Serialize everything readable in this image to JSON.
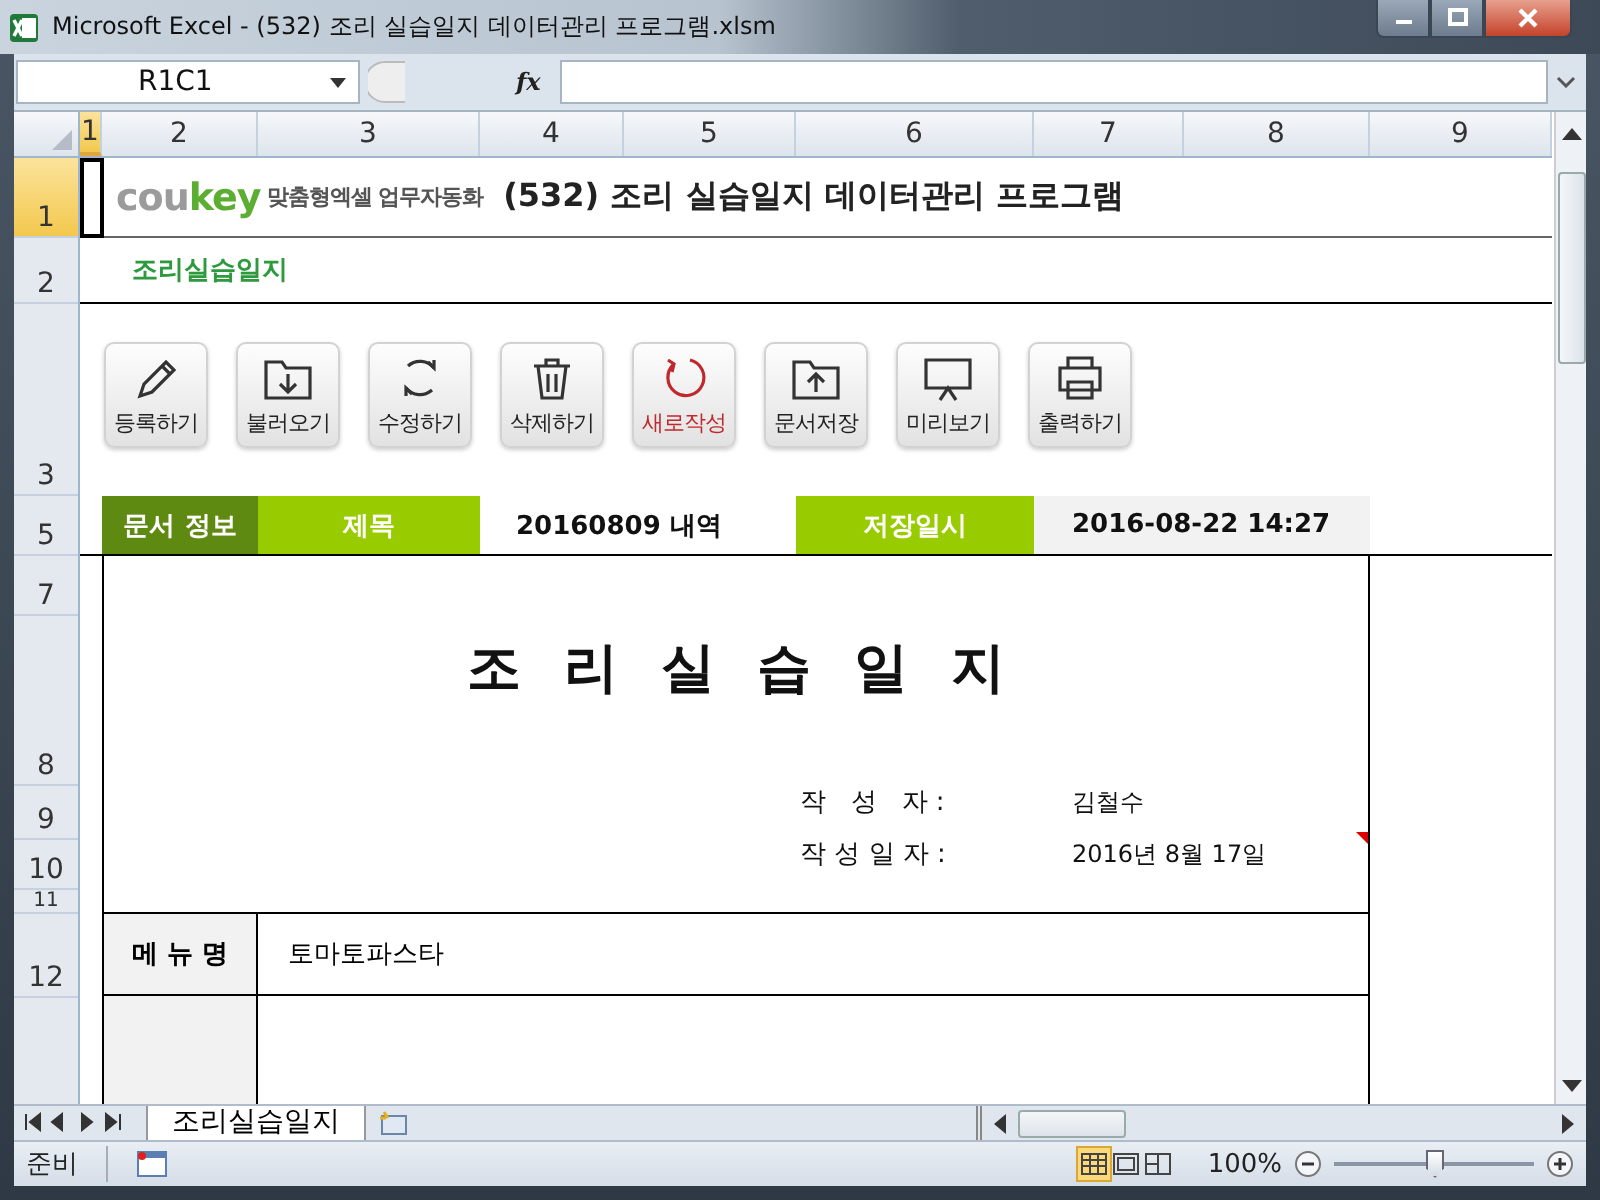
{
  "window": {
    "title": "Microsoft Excel - (532) 조리 실습일지 데이터관리 프로그램.xlsm"
  },
  "formula_bar": {
    "name_box": "R1C1",
    "function_label": "fx"
  },
  "columns": [
    {
      "label": "1",
      "selected": true
    },
    {
      "label": "2",
      "selected": false
    },
    {
      "label": "3",
      "selected": false
    },
    {
      "label": "4",
      "selected": false
    },
    {
      "label": "5",
      "selected": false
    },
    {
      "label": "6",
      "selected": false
    },
    {
      "label": "7",
      "selected": false
    },
    {
      "label": "8",
      "selected": false
    },
    {
      "label": "9",
      "selected": false
    }
  ],
  "rows": [
    {
      "label": "1",
      "selected": true
    },
    {
      "label": "2",
      "selected": false
    },
    {
      "label": "3",
      "selected": false
    },
    {
      "label": "5",
      "selected": false
    },
    {
      "label": "7",
      "selected": false
    },
    {
      "label": "8",
      "selected": false
    },
    {
      "label": "9",
      "selected": false
    },
    {
      "label": "10",
      "selected": false
    },
    {
      "label": "11",
      "selected": false
    },
    {
      "label": "12",
      "selected": false
    }
  ],
  "header": {
    "logo": [
      {
        "text": "cou",
        "color": "#9b9b9b"
      },
      {
        "text": "key",
        "color": "#5cae32"
      }
    ],
    "tagline": "맞춤형엑셀 업무자동화",
    "title": "(532) 조리 실습일지 데이터관리 프로그램"
  },
  "subtitle": "조리실습일지",
  "toolbar": [
    {
      "label": "등록하기",
      "kind": "pencil",
      "accent": false
    },
    {
      "label": "불러오기",
      "kind": "folder_down",
      "accent": false
    },
    {
      "label": "수정하기",
      "kind": "sync",
      "accent": false
    },
    {
      "label": "삭제하기",
      "kind": "trash",
      "accent": false
    },
    {
      "label": "새로작성",
      "kind": "refresh",
      "accent": true
    },
    {
      "label": "문서저장",
      "kind": "folder_up",
      "accent": false
    },
    {
      "label": "미리보기",
      "kind": "monitor",
      "accent": false
    },
    {
      "label": "출력하기",
      "kind": "printer",
      "accent": false
    }
  ],
  "info_bar": [
    {
      "text": "문서 정보",
      "kind": "section"
    },
    {
      "text": "제목",
      "kind": "label"
    },
    {
      "text": "20160809 내역",
      "kind": "value"
    },
    {
      "text": "저장일시",
      "kind": "label"
    },
    {
      "text": "2016-08-22 14:27",
      "kind": "shaded"
    }
  ],
  "document": {
    "title": "조 리 실 습 일 지",
    "fields": [
      {
        "label": "작   성   자 :",
        "value": "김철수",
        "comment": false
      },
      {
        "label": "작 성 일 자 :",
        "value": "2016년 8월 17일",
        "comment": true
      }
    ],
    "table": [
      {
        "label": "메 뉴 명",
        "value": "토마토파스타"
      }
    ]
  },
  "sheet_tabs": [
    {
      "label": "조리실습일지",
      "selected": true
    }
  ],
  "status_bar": {
    "status": "준비",
    "views": [
      {
        "kind": "normal",
        "selected": true
      },
      {
        "kind": "page_layout",
        "selected": false
      },
      {
        "kind": "page_break",
        "selected": false
      }
    ],
    "zoom": "100%",
    "zoom_slider": {
      "level": 0.5
    }
  }
}
